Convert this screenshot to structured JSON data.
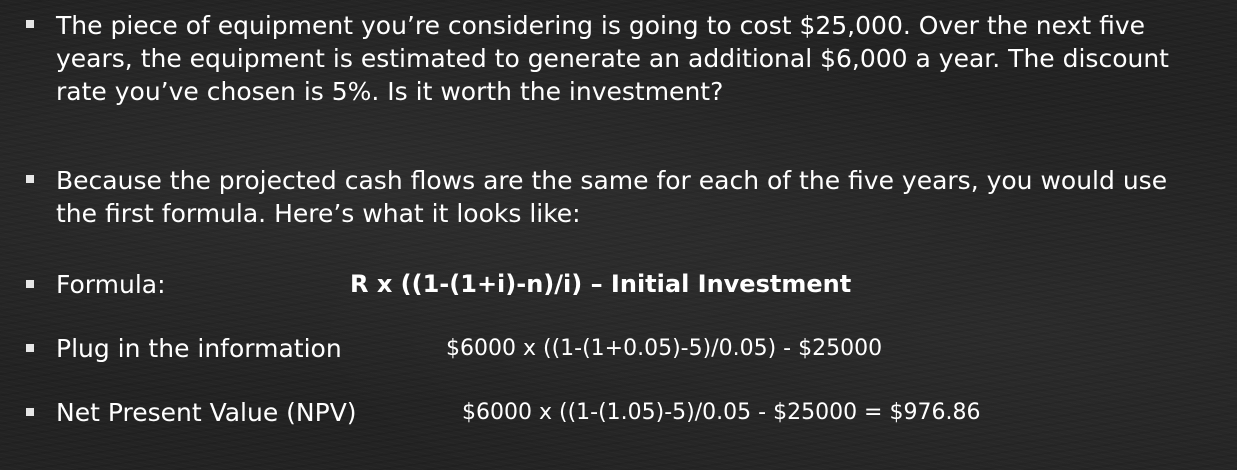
{
  "bullets": [
    {
      "text": "The piece of equipment you’re considering is going to cost $25,000. Over the next five years, the equipment is estimated to generate an additional $6,000 a year. The discount rate you’ve chosen is 5%. Is it worth the investment?"
    },
    {
      "text": "Because the projected cash flows are the same for each of the five years, you would use the first formula. Here’s what it looks like:"
    },
    {
      "label": "Formula:",
      "value": "R x ((1-(1+i)-n)/i) – Initial Investment"
    },
    {
      "label": "Plug in the information",
      "value": "$6000 x ((1-(1+0.05)-5)/0.05) - $25000"
    },
    {
      "label": "Net Present Value (NPV)",
      "value": "$6000 x ((1-(1.05)-5)/0.05 - $25000 = $976.86"
    }
  ]
}
